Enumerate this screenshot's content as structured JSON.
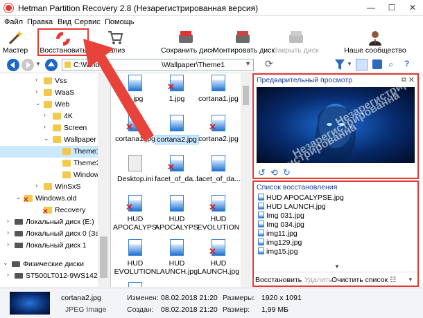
{
  "window": {
    "title": "Hetman Partition Recovery 2.8 (Незарегистрированная версия)"
  },
  "menu": [
    "Файл",
    "Правка",
    "Вид",
    "Сервис",
    "Помощь"
  ],
  "toolbar": {
    "wizard": "Мастер",
    "restore": "Восстановить",
    "analysis": "нализ",
    "save_disk": "Сохранить диск",
    "mount_disk": "Монтировать диск",
    "close_disk": "Закрыть диск",
    "community": "Наше сообщество"
  },
  "address": {
    "path": "C:\\Windows\\Web\\Wallpaper\\Theme1",
    "path_left": "C:\\Windo",
    "path_right": "\\Wallpaper\\Theme1"
  },
  "tree": {
    "items": [
      "Vss",
      "WaaS",
      "Web",
      "4K",
      "Screen",
      "Wallpaper",
      "Theme1",
      "Theme2",
      "Windows",
      "WinSxS",
      "Windows.old",
      "Recovery",
      "Локальный диск (E:)",
      "Локальный диск 0 (За",
      "Локальный диск 1"
    ],
    "physical_header": "Физические диски",
    "physical_items": [
      "ST500LT012-9WS142"
    ]
  },
  "files": [
    {
      "name": "1.jpg",
      "deleted": false
    },
    {
      "name": "1.jpg",
      "deleted": true
    },
    {
      "name": "cortana1.jpg",
      "deleted": false
    },
    {
      "name": "cortana1.jpg",
      "deleted": true
    },
    {
      "name": "cortana2.jpg",
      "deleted": false
    },
    {
      "name": "cortana2.jpg",
      "deleted": true
    },
    {
      "name": "Desktop.ini",
      "deleted": false
    },
    {
      "name": "facet_of_da...",
      "deleted": true
    },
    {
      "name": "facet_of_da...",
      "deleted": false
    },
    {
      "name": "HUD APOCALYPSE",
      "deleted": true
    },
    {
      "name": "HUD APOCALYPSE",
      "deleted": false
    },
    {
      "name": "HUD EVOLUTION",
      "deleted": true
    },
    {
      "name": "HUD EVOLUTION",
      "deleted": false
    },
    {
      "name": "HUD LAUNCH.jpg",
      "deleted": false
    },
    {
      "name": "HUD LAUNCH.jpg",
      "deleted": true
    }
  ],
  "preview": {
    "title": "Предварительный просмотр",
    "watermark": "Незарегистрированна"
  },
  "recovery_list": {
    "title": "Список восстановления",
    "items": [
      "HUD APOCALYPSE.jpg",
      "HUD LAUNCH.jpg",
      "Img 031.jpg",
      "Img 034.jpg",
      "img11.jpg",
      "img129.jpg",
      "img15.jpg"
    ],
    "restore_label": "Восстановить",
    "delete_label": "Удалить",
    "clear_label": "Очистить список"
  },
  "status": {
    "filename": "cortana2.jpg",
    "filetype": "JPEG Image",
    "modified_label": "Изменен:",
    "modified_value": "08.02.2018 21:20",
    "created_label": "Создан:",
    "created_value": "08.02.2018 21:20",
    "dimensions_label": "Размеры:",
    "dimensions_value": "1920 x 1091",
    "size_label": "Размер:",
    "size_value": "1,99 МБ"
  },
  "colors": {
    "highlight": "#e53935",
    "selection": "#cce8ff",
    "accent": "#1c3f94"
  }
}
